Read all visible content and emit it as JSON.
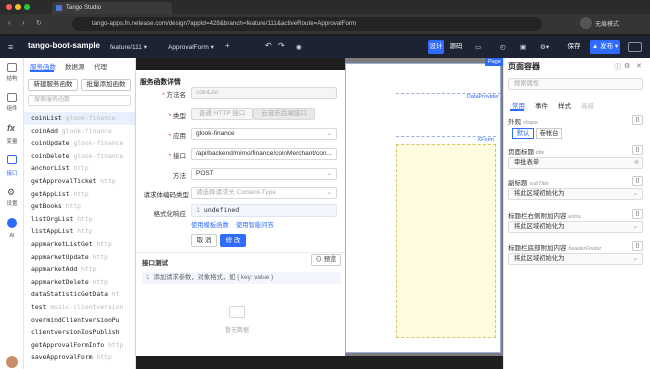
{
  "browser": {
    "tab_title": "Tango Studio",
    "url": "tango-apps.fn.netease.com/design?appId=428&branch=feature/111&activeRoute=ApprovalForm",
    "profile": "无痕模式"
  },
  "header": {
    "app_title": "tango-boot-sample",
    "branch": "feature/111",
    "page": "ApprovalForm",
    "design_label": "设计",
    "source_label": "源码",
    "save_label": "保存",
    "publish_label": "发布"
  },
  "rail": {
    "items": [
      {
        "label": "结构",
        "icon": "structure-icon"
      },
      {
        "label": "组件",
        "icon": "components-icon"
      },
      {
        "label": "变量",
        "icon": "fx-icon"
      },
      {
        "label": "接口",
        "icon": "api-icon"
      },
      {
        "label": "设置",
        "icon": "settings-icon"
      },
      {
        "label": "AI",
        "icon": "ai-icon"
      }
    ]
  },
  "functions": {
    "tabs": [
      "服务函数",
      "数据源",
      "代理"
    ],
    "new_button": "新建服务函数",
    "batch_button": "批量添加函数",
    "search_placeholder": "搜索服务函数",
    "items": [
      {
        "name": "coinList",
        "ns": "glook-finance"
      },
      {
        "name": "coinAdd",
        "ns": "glook-finance"
      },
      {
        "name": "coinUpdate",
        "ns": "glook-finance"
      },
      {
        "name": "coinDelete",
        "ns": "glook-finance"
      },
      {
        "name": "anchorList",
        "ns": "http"
      },
      {
        "name": "getApprovalTicket",
        "ns": "http"
      },
      {
        "name": "getAppList",
        "ns": "http"
      },
      {
        "name": "getBooks",
        "ns": "http"
      },
      {
        "name": "listOrgList",
        "ns": "http"
      },
      {
        "name": "listAppList",
        "ns": "http"
      },
      {
        "name": "appmarketListGet",
        "ns": "http"
      },
      {
        "name": "appmarketUpdate",
        "ns": "http"
      },
      {
        "name": "appmarketAdd",
        "ns": "http"
      },
      {
        "name": "appmarketDelete",
        "ns": "http"
      },
      {
        "name": "dataStatisticGetData",
        "ns": "ht"
      },
      {
        "name": "test",
        "ns": "music-clientversion"
      },
      {
        "name": "overmindClientversionPu",
        "ns": ""
      },
      {
        "name": "clientversionIosPublish",
        "ns": ""
      },
      {
        "name": "getApprovalFormInfo",
        "ns": "http"
      },
      {
        "name": "saveApprovalForm",
        "ns": "http"
      }
    ]
  },
  "detail": {
    "section_title": "服务函数详情",
    "name_label": "方法名",
    "name_value": "coinList",
    "type_label": "类型",
    "type_http": "普通 HTTP 接口",
    "type_cloud": "云音乐后端接口",
    "app_label": "应用",
    "app_value": "glook-finance",
    "api_label": "接口",
    "api_value": "/api/backend/mimo/finance/coinMerchant/con...",
    "method_label": "方法",
    "method_value": "POST",
    "encoding_label": "请求体编码类型",
    "encoding_placeholder": "请选择请求头 Content-Type",
    "format_label": "格式化响应",
    "format_line_no": "1",
    "format_value": "undefined",
    "template_link": "使用模板函数",
    "smart_link": "使用智能问答",
    "cancel_label": "取 消",
    "edit_label": "修 改",
    "test_title": "接口测试",
    "preview_label": "预览",
    "test_line_no": "1",
    "test_placeholder": "添加请求参数，对象格式，如 { key: value }",
    "empty_label": "暂无数据"
  },
  "canvas": {
    "page_badge": "Page",
    "dataprovider": "DataProvider",
    "xform": "XForm"
  },
  "props": {
    "title": "页面容器",
    "search_placeholder": "搜索属性",
    "tabs": [
      "常用",
      "事件",
      "样式",
      "高级"
    ],
    "appearance_label": "外观",
    "appearance_key": "shape",
    "shape_default": "默认",
    "shape_card": "卷帐台",
    "title_label": "页面标题",
    "title_key": "title",
    "title_value": "审批表单",
    "subtitle_label": "副标题",
    "subtitle_key": "subTitle",
    "subtitle_value": "将此区域初始化为",
    "extra_label": "标题栏右侧附加内容",
    "extra_key": "extra",
    "extra_value": "将此区域初始化为",
    "footer_label": "标题栏底部附加内容",
    "footer_key": "headerFooter",
    "footer_value": "将此区域初始化为",
    "obj_btn": "{}"
  },
  "colors": {
    "accent": "#2f6bff",
    "header_bg": "#1d2333"
  }
}
